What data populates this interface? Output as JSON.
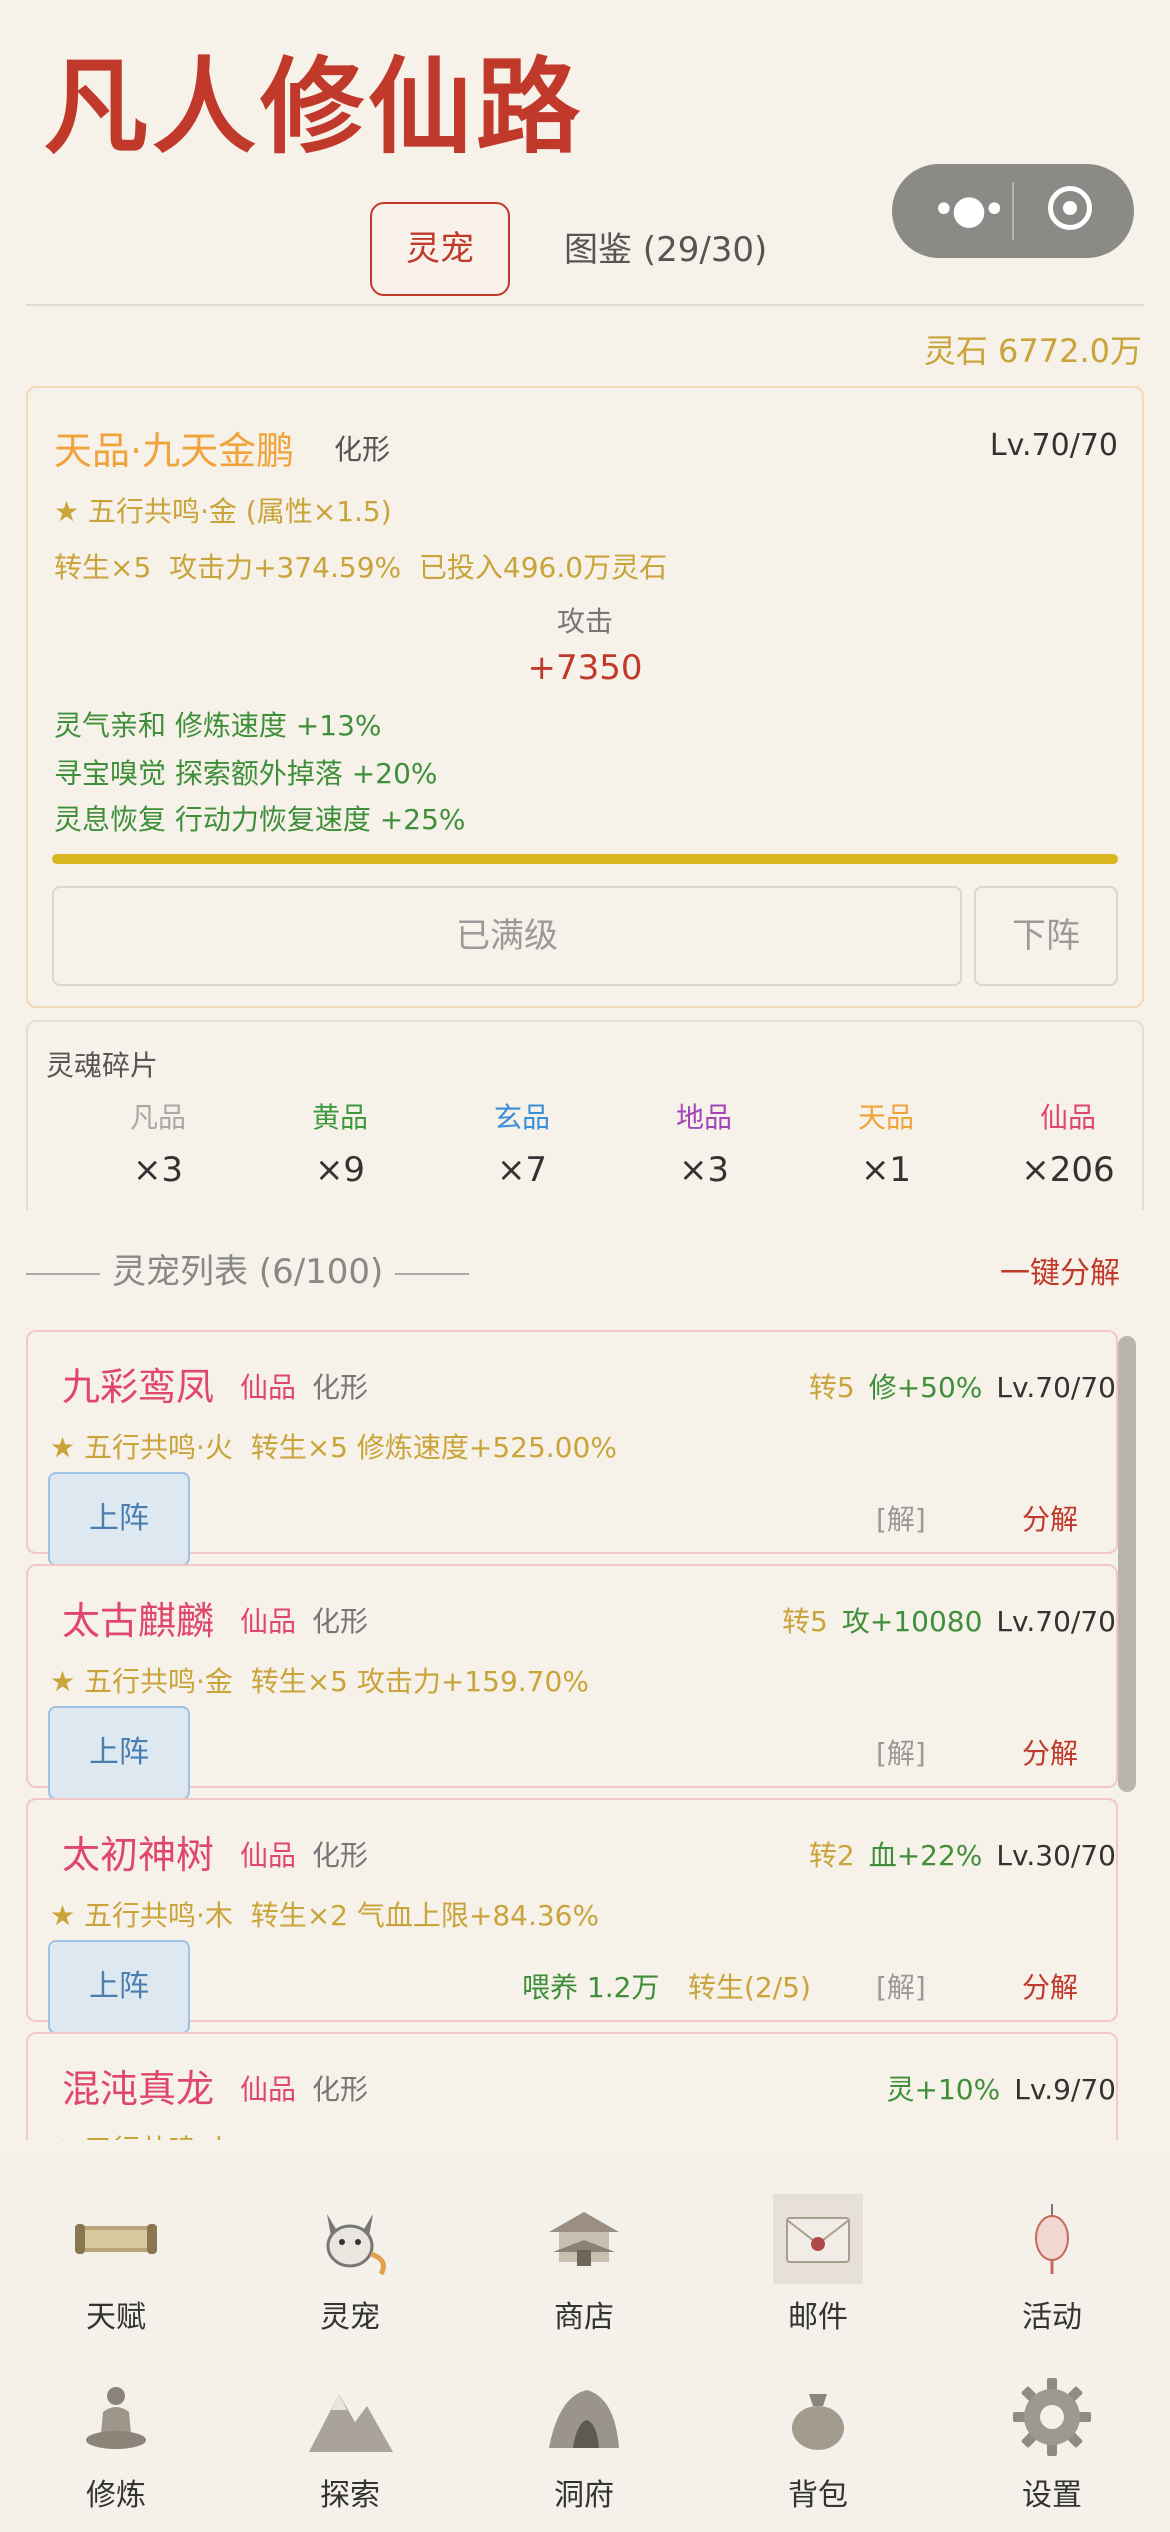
{
  "header": {
    "title": "凡人修仙路",
    "tabs": [
      {
        "label": "灵宠",
        "active": true
      },
      {
        "label": "图鉴 (29/30)",
        "active": false
      }
    ],
    "stones": "灵石 6772.0万"
  },
  "active_pet": {
    "name": "天品·九天金鹏",
    "form": "化形",
    "level": "Lv.70/70",
    "resonance": "★ 五行共鸣·金 (属性×1.5)",
    "stats": "转生×5  攻击力+374.59%  已投入496.0万灵石",
    "attack_label": "攻击",
    "attack_value": "+7350",
    "buffs": [
      "灵气亲和 修炼速度 +13%",
      "寻宝嗅觉 探索额外掉落 +20%",
      "灵息恢复 行动力恢复速度 +25%"
    ],
    "xp_progress": 1.0,
    "max_button": "已满级",
    "unequip_button": "下阵"
  },
  "fragments": {
    "title": "灵魂碎片",
    "items": [
      {
        "grade": "凡品",
        "count": "×3",
        "color": "#a8a8a8"
      },
      {
        "grade": "黄品",
        "count": "×9",
        "color": "#3f9a3f"
      },
      {
        "grade": "玄品",
        "count": "×7",
        "color": "#3b8fd9"
      },
      {
        "grade": "地品",
        "count": "×3",
        "color": "#a347b8"
      },
      {
        "grade": "天品",
        "count": "×1",
        "color": "#f0a33a"
      },
      {
        "grade": "仙品",
        "count": "×206",
        "color": "#e0476a"
      }
    ]
  },
  "pet_list": {
    "header": "灵宠列表 (6/100)",
    "decompose_all": "一键分解",
    "equip_label": "上阵",
    "items": [
      {
        "name": "九彩鸾凤",
        "grade": "仙品",
        "form": "化形",
        "rebirth": "转5",
        "bonus": "修+50%",
        "level": "Lv.70/70",
        "desc": "★ 五行共鸣·火  转生×5 修炼速度+525.00%",
        "feed": "",
        "rebirth_progress": "",
        "unlock": "[解]",
        "decompose": "分解"
      },
      {
        "name": "太古麒麟",
        "grade": "仙品",
        "form": "化形",
        "rebirth": "转5",
        "bonus": "攻+10080",
        "level": "Lv.70/70",
        "desc": "★ 五行共鸣·金  转生×5 攻击力+159.70%",
        "feed": "",
        "rebirth_progress": "",
        "unlock": "[解]",
        "decompose": "分解"
      },
      {
        "name": "太初神树",
        "grade": "仙品",
        "form": "化形",
        "rebirth": "转2",
        "bonus": "血+22%",
        "level": "Lv.30/70",
        "desc": "★ 五行共鸣·木  转生×2 气血上限+84.36%",
        "feed": "喂养 1.2万",
        "rebirth_progress": "转生(2/5)",
        "unlock": "[解]",
        "decompose": "分解"
      },
      {
        "name": "混沌真龙",
        "grade": "仙品",
        "form": "化形",
        "rebirth": "",
        "bonus": "灵+10%",
        "level": "Lv.9/70",
        "desc": "★ 五行共鸣·火",
        "feed": "",
        "rebirth_progress": "",
        "unlock": "",
        "decompose": ""
      }
    ]
  },
  "tabbar": {
    "row1": [
      {
        "label": "天赋",
        "icon": "scroll-icon"
      },
      {
        "label": "灵宠",
        "icon": "fox-icon"
      },
      {
        "label": "商店",
        "icon": "pavilion-icon"
      },
      {
        "label": "邮件",
        "icon": "envelope-icon"
      },
      {
        "label": "活动",
        "icon": "lantern-icon"
      }
    ],
    "row2": [
      {
        "label": "修炼",
        "icon": "meditation-icon"
      },
      {
        "label": "探索",
        "icon": "mountain-icon"
      },
      {
        "label": "洞府",
        "icon": "cave-icon"
      },
      {
        "label": "背包",
        "icon": "bag-icon"
      },
      {
        "label": "设置",
        "icon": "gear-icon"
      }
    ]
  },
  "colors": {
    "accent_red": "#c0392b",
    "gold": "#c9a43a",
    "immortal_pink": "#e0476a",
    "green": "#3f8f3a"
  }
}
